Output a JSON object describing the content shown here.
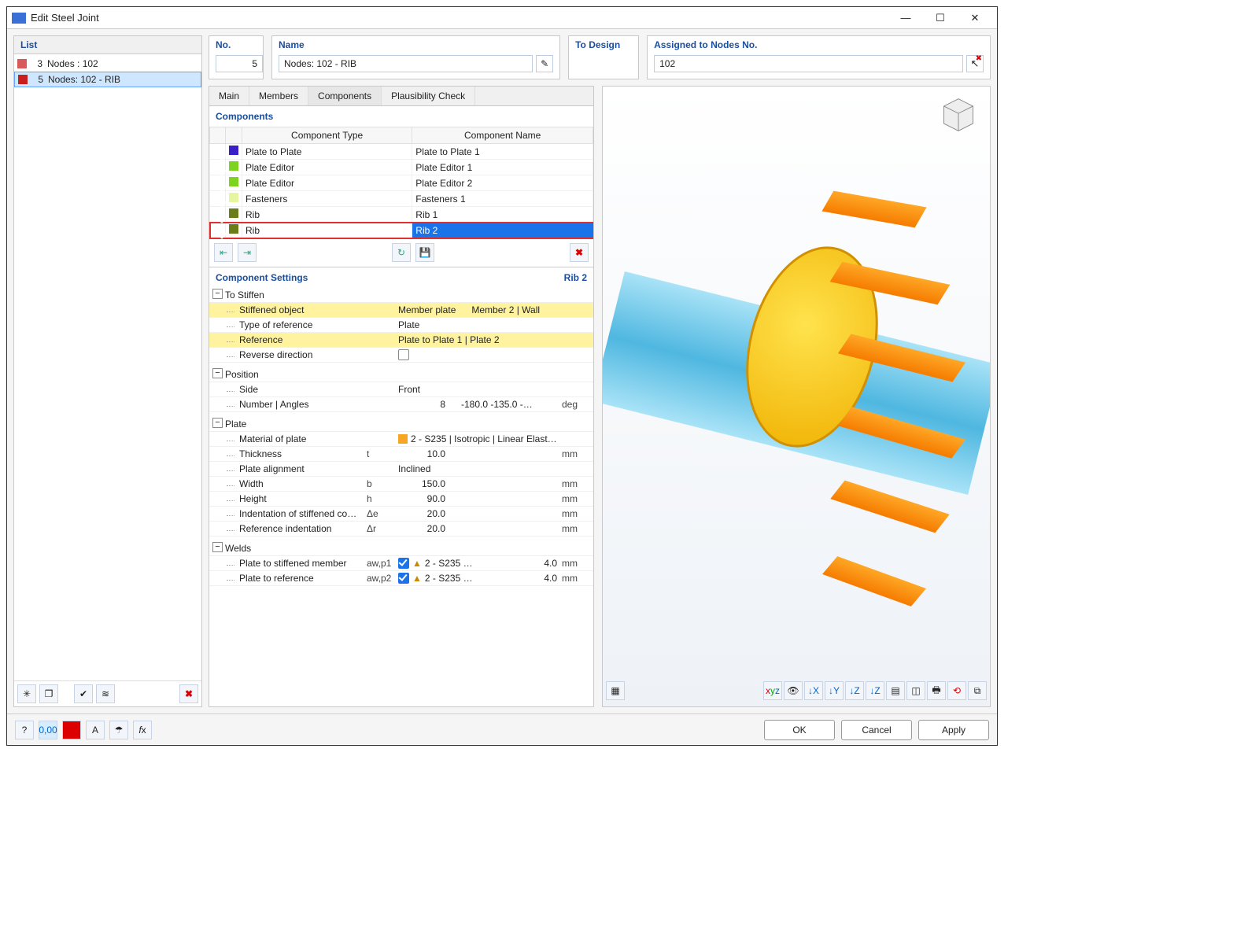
{
  "window": {
    "title": "Edit Steel Joint"
  },
  "left": {
    "header": "List",
    "rows": [
      {
        "color": "#d85a5a",
        "num": "3",
        "label": "Nodes : 102",
        "selected": false
      },
      {
        "color": "#c81e1e",
        "num": "5",
        "label": "Nodes: 102 - RIB",
        "selected": true
      }
    ]
  },
  "top": {
    "no_label": "No.",
    "no_value": "5",
    "name_label": "Name",
    "name_value": "Nodes: 102 - RIB",
    "todesign_label": "To Design",
    "assigned_label": "Assigned to Nodes No.",
    "assigned_value": "102"
  },
  "tabs": [
    "Main",
    "Members",
    "Components",
    "Plausibility Check"
  ],
  "active_tab": 2,
  "components_title": "Components",
  "component_headers": {
    "type": "Component Type",
    "name": "Component Name"
  },
  "components": [
    {
      "on": true,
      "color": "#3a1ec8",
      "type": "Plate to Plate",
      "name": "Plate to Plate 1"
    },
    {
      "on": true,
      "color": "#7ed321",
      "type": "Plate Editor",
      "name": "Plate Editor 1"
    },
    {
      "on": true,
      "color": "#7ed321",
      "type": "Plate Editor",
      "name": "Plate Editor 2"
    },
    {
      "on": true,
      "color": "#e6f5a0",
      "type": "Fasteners",
      "name": "Fasteners 1"
    },
    {
      "on": true,
      "color": "#6b7d1a",
      "type": "Rib",
      "name": "Rib 1"
    },
    {
      "on": true,
      "color": "#6b7d1a",
      "type": "Rib",
      "name": "Rib 2",
      "selected": true
    }
  ],
  "settings": {
    "title": "Component Settings",
    "current": "Rib 2",
    "groups": [
      {
        "title": "To Stiffen",
        "rows": [
          {
            "k": "Stiffened object",
            "v": "Member plate",
            "extra": "Member 2 | Wall",
            "hl": true
          },
          {
            "k": "Type of reference",
            "v": "Plate"
          },
          {
            "k": "Reference",
            "v": "Plate to Plate 1 | Plate 2",
            "hl": true
          },
          {
            "k": "Reverse direction",
            "v": "",
            "checkbox": true
          }
        ]
      },
      {
        "title": "Position",
        "rows": [
          {
            "k": "Side",
            "v": "Front"
          },
          {
            "k": "Number | Angles",
            "v": "8",
            "extra": "-180.0 -135.0 -…",
            "u": "deg",
            "num": true
          }
        ]
      },
      {
        "title": "Plate",
        "rows": [
          {
            "k": "Material of plate",
            "v": "2 - S235 | Isotropic | Linear Elast…",
            "swatch": "#f5a623"
          },
          {
            "k": "Thickness",
            "s": "t",
            "v": "10.0",
            "u": "mm",
            "num": true
          },
          {
            "k": "Plate alignment",
            "v": "Inclined"
          },
          {
            "k": "Width",
            "s": "b",
            "v": "150.0",
            "u": "mm",
            "num": true
          },
          {
            "k": "Height",
            "s": "h",
            "v": "90.0",
            "u": "mm",
            "num": true
          },
          {
            "k": "Indentation of stiffened co…",
            "s": "Δe",
            "v": "20.0",
            "u": "mm",
            "num": true
          },
          {
            "k": "Reference indentation",
            "s": "Δr",
            "v": "20.0",
            "u": "mm",
            "num": true
          }
        ]
      },
      {
        "title": "Welds",
        "rows": [
          {
            "k": "Plate to stiffened member",
            "s": "aw,p1",
            "weld": true,
            "mat": "2 - S235 …",
            "v": "4.0",
            "u": "mm",
            "num": true
          },
          {
            "k": "Plate to reference",
            "s": "aw,p2",
            "weld": true,
            "mat": "2 - S235 …",
            "v": "4.0",
            "u": "mm",
            "num": true
          }
        ]
      }
    ]
  },
  "footer": {
    "ok": "OK",
    "cancel": "Cancel",
    "apply": "Apply"
  }
}
